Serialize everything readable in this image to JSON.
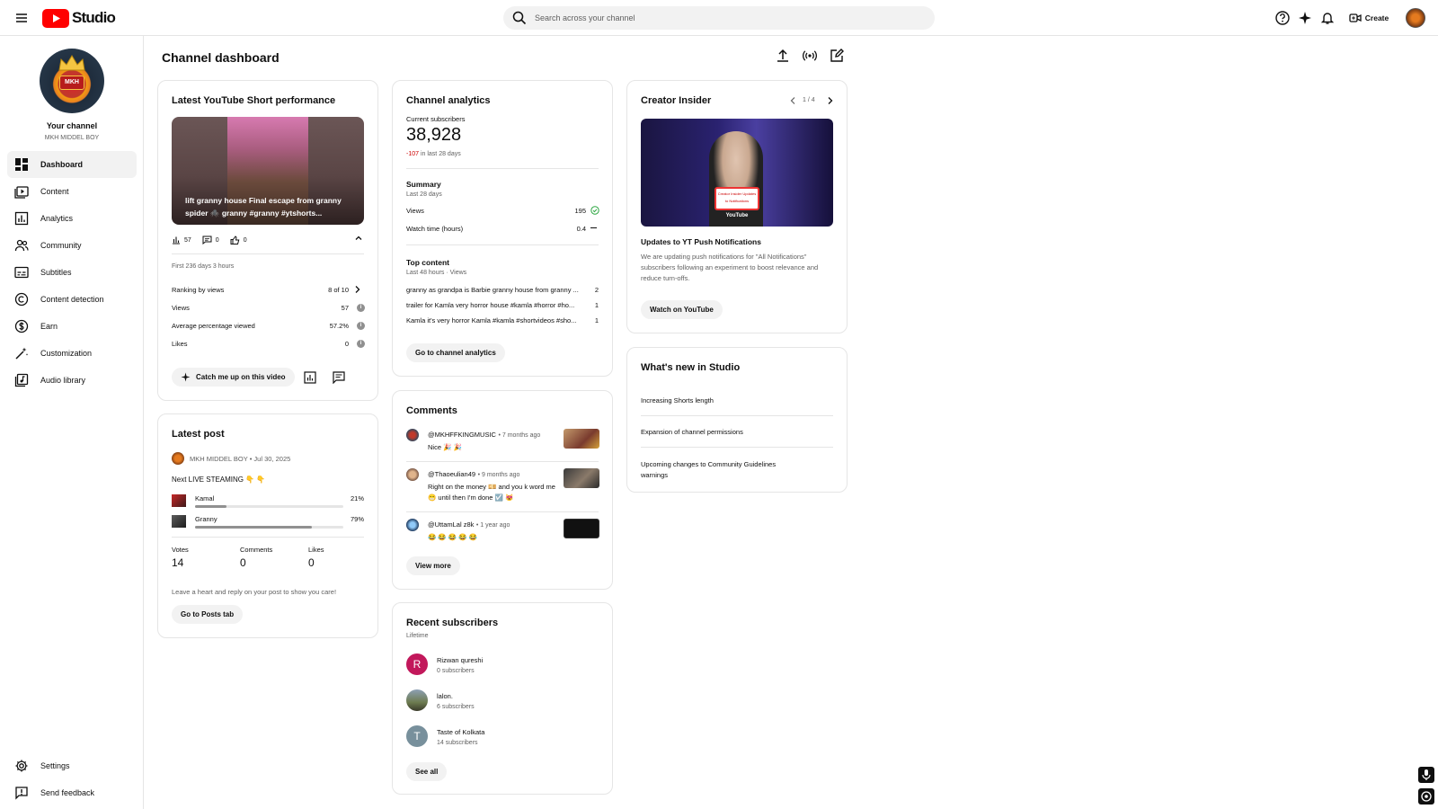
{
  "topbar": {
    "logo_text": "Studio",
    "search_placeholder": "Search across your channel",
    "create_label": "Create"
  },
  "sidebar": {
    "your_channel": "Your channel",
    "channel_name": "MKH MIDDEL BOY",
    "avatar_text": "MKH",
    "items": [
      {
        "label": "Dashboard",
        "icon": "dashboard-icon",
        "active": true
      },
      {
        "label": "Content",
        "icon": "content-icon"
      },
      {
        "label": "Analytics",
        "icon": "analytics-icon"
      },
      {
        "label": "Community",
        "icon": "community-icon"
      },
      {
        "label": "Subtitles",
        "icon": "subtitles-icon"
      },
      {
        "label": "Content detection",
        "icon": "copyright-icon"
      },
      {
        "label": "Earn",
        "icon": "dollar-icon"
      },
      {
        "label": "Customization",
        "icon": "magic-wand-icon"
      },
      {
        "label": "Audio library",
        "icon": "audio-library-icon"
      }
    ],
    "bottom_items": [
      {
        "label": "Settings",
        "icon": "gear-icon"
      },
      {
        "label": "Send feedback",
        "icon": "feedback-icon"
      }
    ]
  },
  "main": {
    "title": "Channel dashboard"
  },
  "short_card": {
    "title": "Latest YouTube Short performance",
    "video_title": "lift granny house Final escape from granny spider 🕷️ granny #granny #ytshorts...",
    "views_count": "57",
    "comments_count": "0",
    "likes_count": "0",
    "period": "First 236 days 3 hours",
    "rows": [
      {
        "label": "Ranking by views",
        "value": "8 of 10"
      },
      {
        "label": "Views",
        "value": "57"
      },
      {
        "label": "Average percentage viewed",
        "value": "57.2%"
      },
      {
        "label": "Likes",
        "value": "0"
      }
    ],
    "catch_up_label": "Catch me up on this video"
  },
  "post_card": {
    "title": "Latest post",
    "author": "MKH MIDDEL BOY",
    "date": "Jul 30, 2025",
    "post_text": "Next LIVE STEAMING 👇 👇",
    "options": [
      {
        "label": "Kamal",
        "percent": "21%",
        "fraction": 0.21
      },
      {
        "label": "Granny",
        "percent": "79%",
        "fraction": 0.79
      }
    ],
    "stats": [
      {
        "label": "Votes",
        "value": "14"
      },
      {
        "label": "Comments",
        "value": "0"
      },
      {
        "label": "Likes",
        "value": "0"
      }
    ],
    "hint": "Leave a heart and reply on your post to show you care!",
    "button": "Go to Posts tab"
  },
  "analytics_card": {
    "title": "Channel analytics",
    "subs_label": "Current subscribers",
    "subs_value": "38,928",
    "subs_change": "-107",
    "subs_change_suffix": "in last 28 days",
    "summary_title": "Summary",
    "summary_period": "Last 28 days",
    "summary_rows": [
      {
        "label": "Views",
        "value": "195"
      },
      {
        "label": "Watch time (hours)",
        "value": "0.4"
      }
    ],
    "top_title": "Top content",
    "top_period": "Last 48 hours · Views",
    "top_rows": [
      {
        "label": "granny as grandpa is Barbie granny house from granny ...",
        "value": "2"
      },
      {
        "label": "trailer for Kamla very horror house #kamla #horror #ho...",
        "value": "1"
      },
      {
        "label": "Kamla it's very horror Kamla #kamla #shortvideos #sho...",
        "value": "1"
      }
    ],
    "button": "Go to channel analytics"
  },
  "comments_card": {
    "title": "Comments",
    "items": [
      {
        "author": "@MKHFFKINGMUSIC",
        "time": "• 7 months ago",
        "text": "Nice 🎉 🎉"
      },
      {
        "author": "@Thaoeulian49",
        "time": "• 9 months ago",
        "text": "Right on the money 💴 and you k word me 😁 until then I'm done ☑️ 😻"
      },
      {
        "author": "@UttamLal z8k",
        "time": "• 1 year ago",
        "text": "😂 😂 😂 😂 😂"
      }
    ],
    "button": "View more"
  },
  "subscribers_card": {
    "title": "Recent subscribers",
    "period": "Lifetime",
    "items": [
      {
        "initial": "R",
        "name": "Rizwan qureshi",
        "subs": "0 subscribers",
        "color": "#c2185b"
      },
      {
        "initial": "",
        "name": "lalon.",
        "subs": "6 subscribers",
        "color": "#6d7b4f"
      },
      {
        "initial": "T",
        "name": "Taste of Kolkata",
        "subs": "14 subscribers",
        "color": "#78909c"
      }
    ],
    "button": "See all"
  },
  "insider_card": {
    "title": "Creator Insider",
    "pager": "1 / 4",
    "sign_text": "Creator Insider Updates to Notifications",
    "yt_badge": "YouTube",
    "headline": "Updates to YT Push Notifications",
    "description": "We are updating push notifications for \"All Notifications\" subscribers following an experiment to boost relevance and reduce turn-offs.",
    "button": "Watch on YouTube"
  },
  "whats_new_card": {
    "title": "What's new in Studio",
    "items": [
      "Increasing Shorts length",
      "Expansion of channel permissions",
      "Upcoming changes to Community Guidelines warnings"
    ]
  },
  "colors": {
    "brand_red": "#ff0000",
    "negative": "#cc0000",
    "check_green": "#2ba640"
  }
}
